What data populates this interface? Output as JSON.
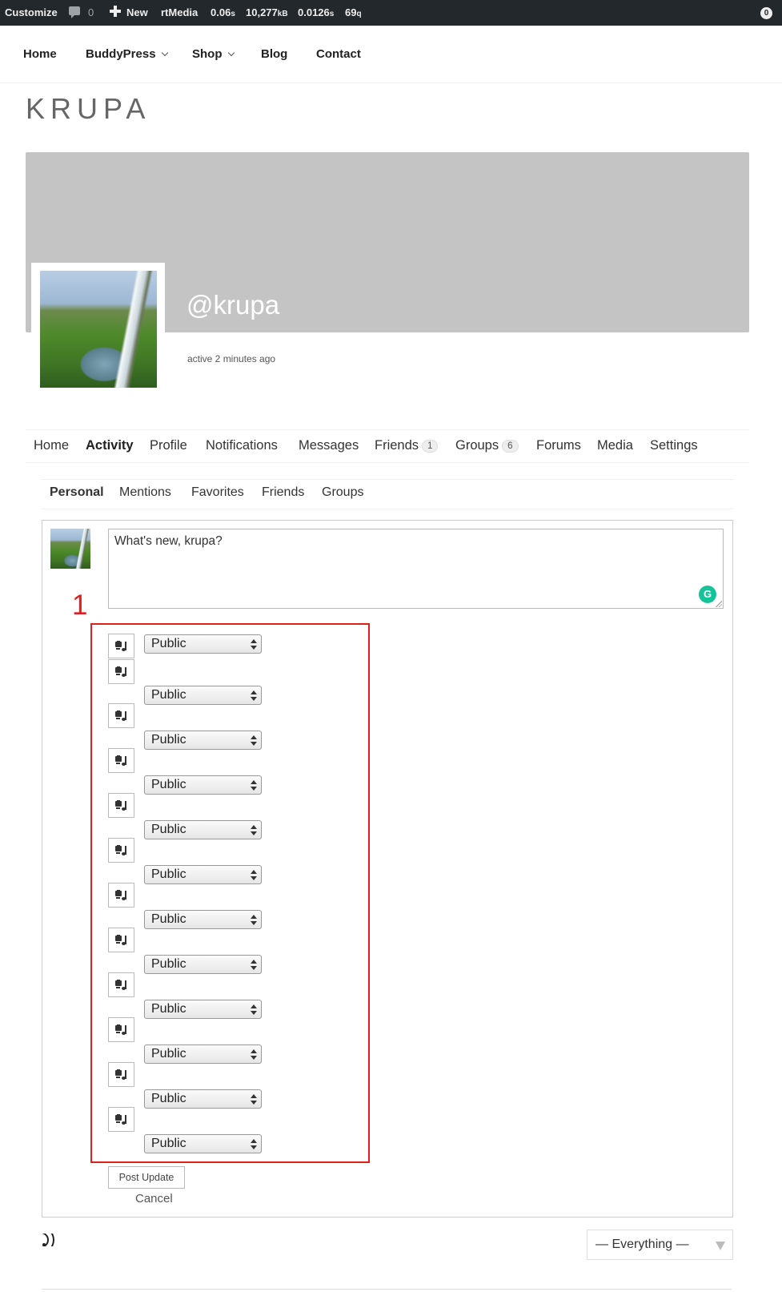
{
  "admin_bar": {
    "customize": "Customize",
    "comments_count": "0",
    "new_label": "New",
    "rtmedia": "rtMedia",
    "time_value": "0.06",
    "time_unit": "s",
    "memory_value": "10,277",
    "memory_unit": "kB",
    "query_time_value": "0.0126",
    "query_time_unit": "s",
    "queries_value": "69",
    "queries_unit": "q",
    "notification_count": "0"
  },
  "main_nav": {
    "home": "Home",
    "buddypress": "BuddyPress",
    "shop": "Shop",
    "blog": "Blog",
    "contact": "Contact"
  },
  "site": {
    "title": "KRUPA"
  },
  "profile": {
    "handle": "@krupa",
    "last_active": "active 2 minutes ago"
  },
  "profile_nav": {
    "home": "Home",
    "activity": "Activity",
    "profile": "Profile",
    "notifications": "Notifications",
    "messages": "Messages",
    "friends": "Friends",
    "friends_count": "1",
    "groups": "Groups",
    "groups_count": "6",
    "forums": "Forums",
    "media": "Media",
    "settings": "Settings"
  },
  "sub_nav": {
    "personal": "Personal",
    "mentions": "Mentions",
    "favorites": "Favorites",
    "friends": "Friends",
    "groups": "Groups"
  },
  "post_form": {
    "placeholder": "What's new, krupa?",
    "grammarly_glyph": "G",
    "annotation_number": "1",
    "privacy_options": [
      "Public",
      "Public",
      "Public",
      "Public",
      "Public",
      "Public",
      "Public",
      "Public",
      "Public",
      "Public",
      "Public",
      "Public"
    ],
    "post_button": "Post Update",
    "cancel": "Cancel"
  },
  "activity_filter": {
    "selected": "— Everything —"
  },
  "icons": {
    "comment": "comment-bubble-icon",
    "new": "plus-icon",
    "upload": "media-upload-icon",
    "rss": "rss-icon",
    "grammarly": "grammarly-icon"
  },
  "colors": {
    "admin_bar_bg": "#23282d",
    "cover_bg": "#c4c4c4",
    "annotation_red": "#e0201c",
    "grammarly_green": "#15c39a"
  }
}
